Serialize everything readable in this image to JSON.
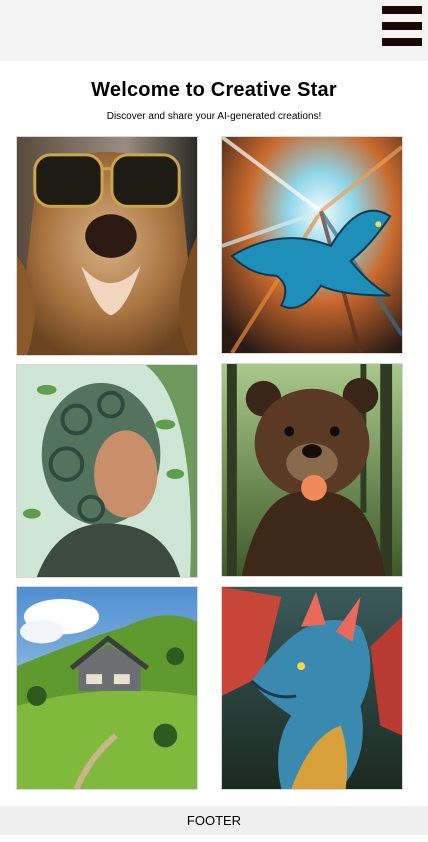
{
  "header": {
    "menu_icon": "hamburger-menu-icon"
  },
  "hero": {
    "title": "Welcome to Creative Star",
    "subtitle": "Discover and share your AI-generated creations!"
  },
  "gallery": {
    "images": [
      {
        "icon": "dog-sunglasses-image"
      },
      {
        "icon": "blue-dragon-speed-image"
      },
      {
        "icon": "cyborg-woman-image"
      },
      {
        "icon": "bear-eating-flower-image"
      },
      {
        "icon": "hillside-house-image"
      },
      {
        "icon": "dragon-portrait-image"
      }
    ]
  },
  "footer": {
    "label": "FOOTER"
  }
}
